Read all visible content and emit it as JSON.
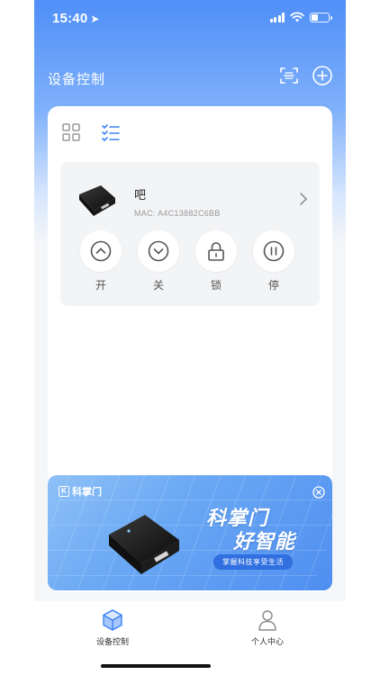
{
  "status_bar": {
    "time": "15:40"
  },
  "header": {
    "title": "设备控制",
    "scan_icon": "scan-icon",
    "add_icon": "add-circle-icon"
  },
  "view_toggle": {
    "grid_icon": "grid-icon",
    "list_icon": "list-icon",
    "active": "list"
  },
  "device": {
    "name": "吧",
    "mac": "MAC: A4C13882C6BB",
    "controls": [
      {
        "label": "开",
        "icon": "chevron-up-icon"
      },
      {
        "label": "关",
        "icon": "chevron-down-icon"
      },
      {
        "label": "锁",
        "icon": "lock-icon"
      },
      {
        "label": "停",
        "icon": "pause-icon"
      }
    ]
  },
  "banner": {
    "brand": "科掌门",
    "headline1": "科掌门",
    "headline2": "好智能",
    "tagline": "掌握科技享受生活"
  },
  "tab_bar": {
    "tabs": [
      {
        "label": "设备控制",
        "icon": "device-cube-icon",
        "active": true
      },
      {
        "label": "个人中心",
        "icon": "person-icon",
        "active": false
      }
    ]
  },
  "colors": {
    "accent": "#3b82f6",
    "header_gradient_top": "#4f8ff7"
  }
}
